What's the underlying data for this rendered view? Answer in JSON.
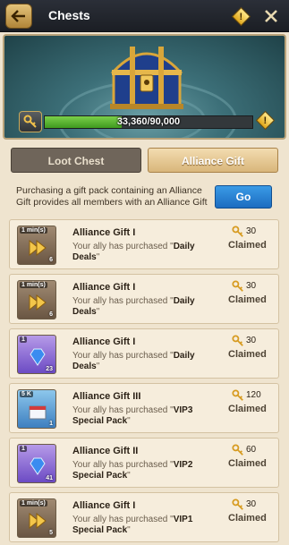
{
  "header": {
    "title": "Chests"
  },
  "hero": {
    "progress_text": "33,360/90,000",
    "progress_fraction": 0.37
  },
  "tabs": [
    {
      "label": "Loot Chest"
    },
    {
      "label": "Alliance Gift"
    }
  ],
  "description": "Purchasing a gift pack containing an Alliance Gift provides all members with an Alliance Gift",
  "go_label": "Go",
  "rows": [
    {
      "tag": "1 min(s)",
      "count": "6",
      "title": "Alliance Gift I",
      "text_prefix": "Your ally has purchased \"",
      "pack": "Daily Deals",
      "text_suffix": "\"",
      "keys": "30",
      "status": "Claimed"
    },
    {
      "tag": "1 min(s)",
      "count": "6",
      "title": "Alliance Gift I",
      "text_prefix": "Your ally has purchased \"",
      "pack": "Daily Deals",
      "text_suffix": "\"",
      "keys": "30",
      "status": "Claimed"
    },
    {
      "tag": "1",
      "count": "23",
      "title": "Alliance Gift I",
      "text_prefix": "Your ally has purchased \"",
      "pack": "Daily Deals",
      "text_suffix": "\"",
      "keys": "30",
      "status": "Claimed"
    },
    {
      "tag": "5 K",
      "count": "1",
      "title": "Alliance Gift III",
      "text_prefix": "Your ally has purchased \"",
      "pack": "VIP3 Special Pack",
      "text_suffix": "\"",
      "keys": "120",
      "status": "Claimed"
    },
    {
      "tag": "1",
      "count": "41",
      "title": "Alliance Gift II",
      "text_prefix": "Your ally has purchased \"",
      "pack": "VIP2 Special Pack",
      "text_suffix": "\"",
      "keys": "60",
      "status": "Claimed"
    },
    {
      "tag": "1 min(s)",
      "count": "5",
      "title": "Alliance Gift I",
      "text_prefix": "Your ally has purchased \"",
      "pack": "VIP1 Special Pack",
      "text_suffix": "\"",
      "keys": "30",
      "status": "Claimed"
    }
  ]
}
